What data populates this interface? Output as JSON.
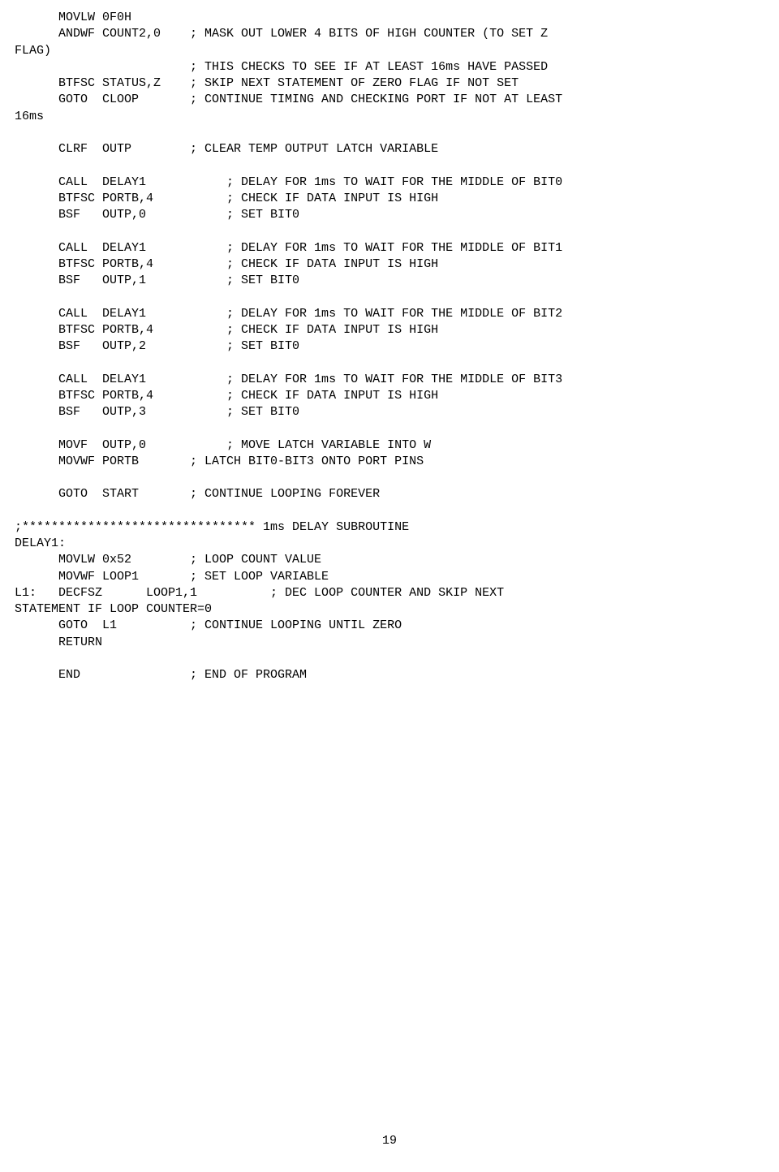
{
  "page_number": "19",
  "code_lines": [
    "      MOVLW 0F0H",
    "      ANDWF COUNT2,0    ; MASK OUT LOWER 4 BITS OF HIGH COUNTER (TO SET Z",
    "FLAG)",
    "                        ; THIS CHECKS TO SEE IF AT LEAST 16ms HAVE PASSED",
    "      BTFSC STATUS,Z    ; SKIP NEXT STATEMENT OF ZERO FLAG IF NOT SET",
    "      GOTO  CLOOP       ; CONTINUE TIMING AND CHECKING PORT IF NOT AT LEAST",
    "16ms",
    "",
    "      CLRF  OUTP        ; CLEAR TEMP OUTPUT LATCH VARIABLE",
    "",
    "      CALL  DELAY1           ; DELAY FOR 1ms TO WAIT FOR THE MIDDLE OF BIT0",
    "      BTFSC PORTB,4          ; CHECK IF DATA INPUT IS HIGH",
    "      BSF   OUTP,0           ; SET BIT0",
    "",
    "      CALL  DELAY1           ; DELAY FOR 1ms TO WAIT FOR THE MIDDLE OF BIT1",
    "      BTFSC PORTB,4          ; CHECK IF DATA INPUT IS HIGH",
    "      BSF   OUTP,1           ; SET BIT0",
    "",
    "      CALL  DELAY1           ; DELAY FOR 1ms TO WAIT FOR THE MIDDLE OF BIT2",
    "      BTFSC PORTB,4          ; CHECK IF DATA INPUT IS HIGH",
    "      BSF   OUTP,2           ; SET BIT0",
    "",
    "      CALL  DELAY1           ; DELAY FOR 1ms TO WAIT FOR THE MIDDLE OF BIT3",
    "      BTFSC PORTB,4          ; CHECK IF DATA INPUT IS HIGH",
    "      BSF   OUTP,3           ; SET BIT0",
    "",
    "      MOVF  OUTP,0           ; MOVE LATCH VARIABLE INTO W",
    "      MOVWF PORTB       ; LATCH BIT0-BIT3 ONTO PORT PINS",
    "",
    "      GOTO  START       ; CONTINUE LOOPING FOREVER",
    "",
    ";******************************** 1ms DELAY SUBROUTINE",
    "DELAY1:",
    "      MOVLW 0x52        ; LOOP COUNT VALUE",
    "      MOVWF LOOP1       ; SET LOOP VARIABLE",
    "L1:   DECFSZ      LOOP1,1          ; DEC LOOP COUNTER AND SKIP NEXT",
    "STATEMENT IF LOOP COUNTER=0",
    "      GOTO  L1          ; CONTINUE LOOPING UNTIL ZERO",
    "      RETURN",
    "",
    "      END               ; END OF PROGRAM"
  ]
}
